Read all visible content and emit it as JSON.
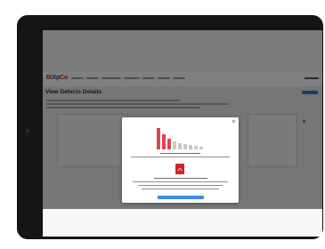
{
  "page": {
    "title": "View Defects Details"
  },
  "colors": {
    "brand_red": "#d2232a",
    "brand_blue": "#1f3e8c",
    "accent_blue": "#2f7ed8",
    "bezel": "#141516"
  },
  "logo": {
    "part1": "Bi",
    "part2": "Xp",
    "part3": "Co"
  },
  "icons": {
    "close": "close-icon",
    "pdf": "pdf-icon"
  }
}
